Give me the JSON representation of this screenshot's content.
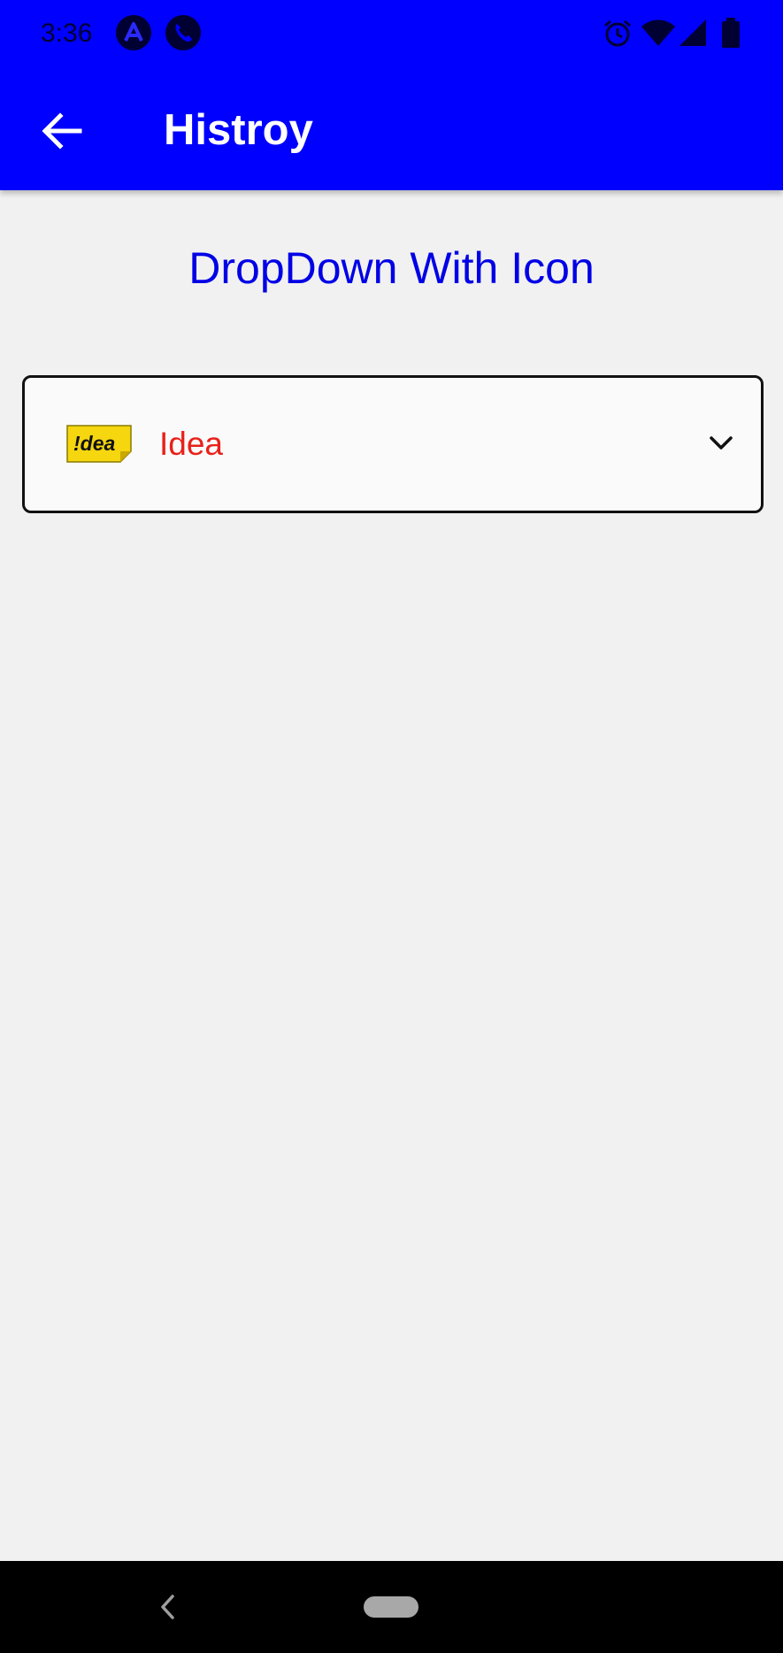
{
  "status_bar": {
    "time": "3:36",
    "left_icons": [
      "a-circle-icon",
      "phone-icon"
    ],
    "right_icons": [
      "alarm-icon",
      "wifi-icon",
      "signal-icon",
      "battery-icon"
    ]
  },
  "app_bar": {
    "title": "Histroy",
    "back_icon": "arrow-left-icon",
    "color": "#0000ff"
  },
  "main": {
    "heading": "DropDown With Icon",
    "heading_color": "#0000e6",
    "dropdown": {
      "selected_label": "Idea",
      "selected_icon_text": "!dea",
      "label_color": "#e8211a",
      "chevron_icon": "chevron-down-icon"
    }
  },
  "nav_bar": {
    "back_icon": "nav-back-icon",
    "home_icon": "home-pill-icon"
  }
}
